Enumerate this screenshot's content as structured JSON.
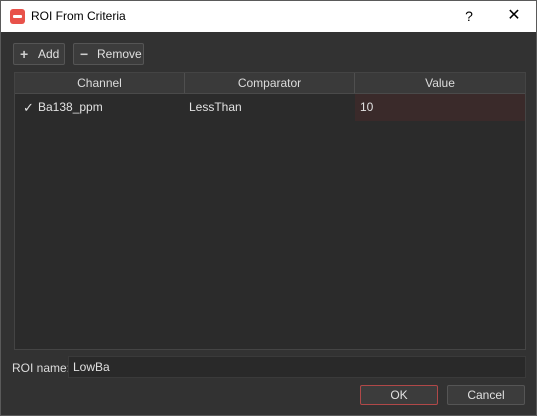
{
  "window": {
    "title": "ROI From Criteria",
    "help_label": "?",
    "close_label": "✕"
  },
  "toolbar": {
    "add_icon": "+",
    "add_label": "Add",
    "remove_icon": "−",
    "remove_label": "Remove"
  },
  "table": {
    "columns": [
      "Channel",
      "Comparator",
      "Value"
    ],
    "rows": [
      {
        "check": "✓",
        "channel": "Ba138_ppm",
        "comparator": "LessThan",
        "value": "10"
      }
    ]
  },
  "roi": {
    "label": "ROI name:",
    "value": "LowBa"
  },
  "buttons": {
    "ok": "OK",
    "cancel": "Cancel"
  },
  "colors": {
    "accent": "#e8524a",
    "ok_border": "#b04848"
  }
}
